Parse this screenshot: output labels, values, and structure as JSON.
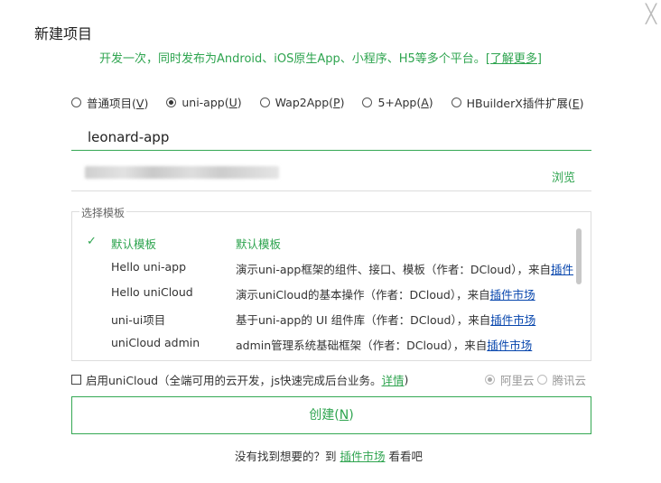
{
  "dialog": {
    "title": "新建项目",
    "close_glyph": "╳",
    "subtitle": "开发一次，同时发布为Android、iOS原生App、小程序、H5等多个平台。",
    "subtitle_link": "[了解更多]"
  },
  "project_types": [
    {
      "label": "普通项目(",
      "key": "V",
      "end": ")",
      "selected": false
    },
    {
      "label": "uni-app(",
      "key": "U",
      "end": ")",
      "selected": true
    },
    {
      "label": "Wap2App(",
      "key": "P",
      "end": ")",
      "selected": false
    },
    {
      "label": "5+App(",
      "key": "A",
      "end": ")",
      "selected": false
    },
    {
      "label": "HBuilderX插件扩展(",
      "key": "E",
      "end": ")",
      "selected": false
    }
  ],
  "project_name": "leonard-app",
  "location": {
    "browse_label": "浏览"
  },
  "templates": {
    "legend": "选择模板",
    "items": [
      {
        "check": "✓",
        "name": "默认模板",
        "desc": "默认模板",
        "market": "",
        "selected": true
      },
      {
        "check": "",
        "name": "Hello uni-app",
        "desc": "演示uni-app框架的组件、接口、模板（作者：DCloud），来自",
        "market": "插件",
        "selected": false
      },
      {
        "check": "",
        "name": "Hello uniCloud",
        "desc": "演示uniCloud的基本操作（作者：DCloud），来自",
        "market": "插件市场",
        "selected": false
      },
      {
        "check": "",
        "name": "uni-ui项目",
        "desc": "基于uni-app的 UI 组件库（作者：DCloud），来自",
        "market": "插件市场",
        "selected": false
      },
      {
        "check": "",
        "name": "uniCloud admin",
        "desc": "admin管理系统基础框架（作者：DCloud），来自",
        "market": "插件市场",
        "selected": false
      }
    ]
  },
  "unicloud": {
    "label": "启用uniCloud（全端可用的云开发，js快速完成后台业务。",
    "detail_link": "详情",
    "label_end": ")",
    "checked": false,
    "providers": [
      {
        "label": "阿里云",
        "selected": true
      },
      {
        "label": "腾讯云",
        "selected": false
      }
    ]
  },
  "create_button": {
    "label": "创建(",
    "key": "N",
    "end": ")"
  },
  "footer": {
    "text_before": "没有找到想要的？到 ",
    "link": "插件市场",
    "text_after": " 看看吧"
  },
  "colors": {
    "accent_green": "#2ea44f",
    "link_blue": "#0645ad"
  }
}
